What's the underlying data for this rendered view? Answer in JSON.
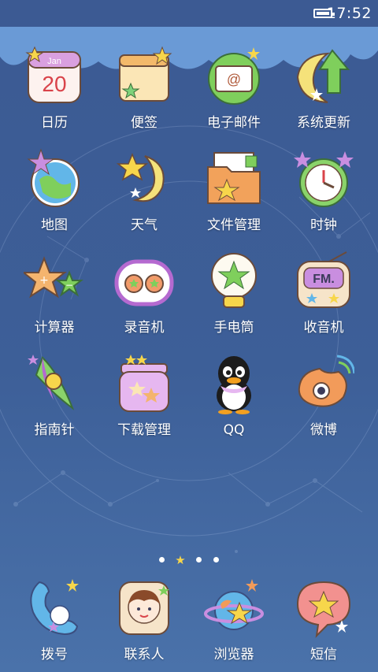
{
  "status_bar": {
    "time": "17:52",
    "battery_icon": "battery-icon"
  },
  "apps": [
    {
      "label": "日历",
      "icon": "calendar-icon",
      "calendar_month": "Jan",
      "calendar_day": "20"
    },
    {
      "label": "便签",
      "icon": "notes-icon"
    },
    {
      "label": "电子邮件",
      "icon": "email-icon",
      "email_glyph": "@"
    },
    {
      "label": "系统更新",
      "icon": "system-update-icon"
    },
    {
      "label": "地图",
      "icon": "map-icon"
    },
    {
      "label": "天气",
      "icon": "weather-icon"
    },
    {
      "label": "文件管理",
      "icon": "file-manager-icon"
    },
    {
      "label": "时钟",
      "icon": "clock-icon"
    },
    {
      "label": "计算器",
      "icon": "calculator-icon"
    },
    {
      "label": "录音机",
      "icon": "recorder-icon"
    },
    {
      "label": "手电筒",
      "icon": "flashlight-icon"
    },
    {
      "label": "收音机",
      "icon": "radio-icon",
      "radio_text": "FM."
    },
    {
      "label": "指南针",
      "icon": "compass-icon"
    },
    {
      "label": "下载管理",
      "icon": "download-manager-icon"
    },
    {
      "label": "QQ",
      "icon": "qq-penguin-icon"
    },
    {
      "label": "微博",
      "icon": "weibo-icon"
    }
  ],
  "page_indicator": {
    "pages": 5,
    "current": 1
  },
  "dock": [
    {
      "label": "拨号",
      "icon": "phone-dialer-icon"
    },
    {
      "label": "联系人",
      "icon": "contacts-icon"
    },
    {
      "label": "浏览器",
      "icon": "browser-icon"
    },
    {
      "label": "短信",
      "icon": "sms-icon"
    }
  ],
  "colors": {
    "background": "#3d5f98",
    "cloud": "#6a9ad6",
    "star": "#f7d64b",
    "moon": "#f5e27a"
  }
}
